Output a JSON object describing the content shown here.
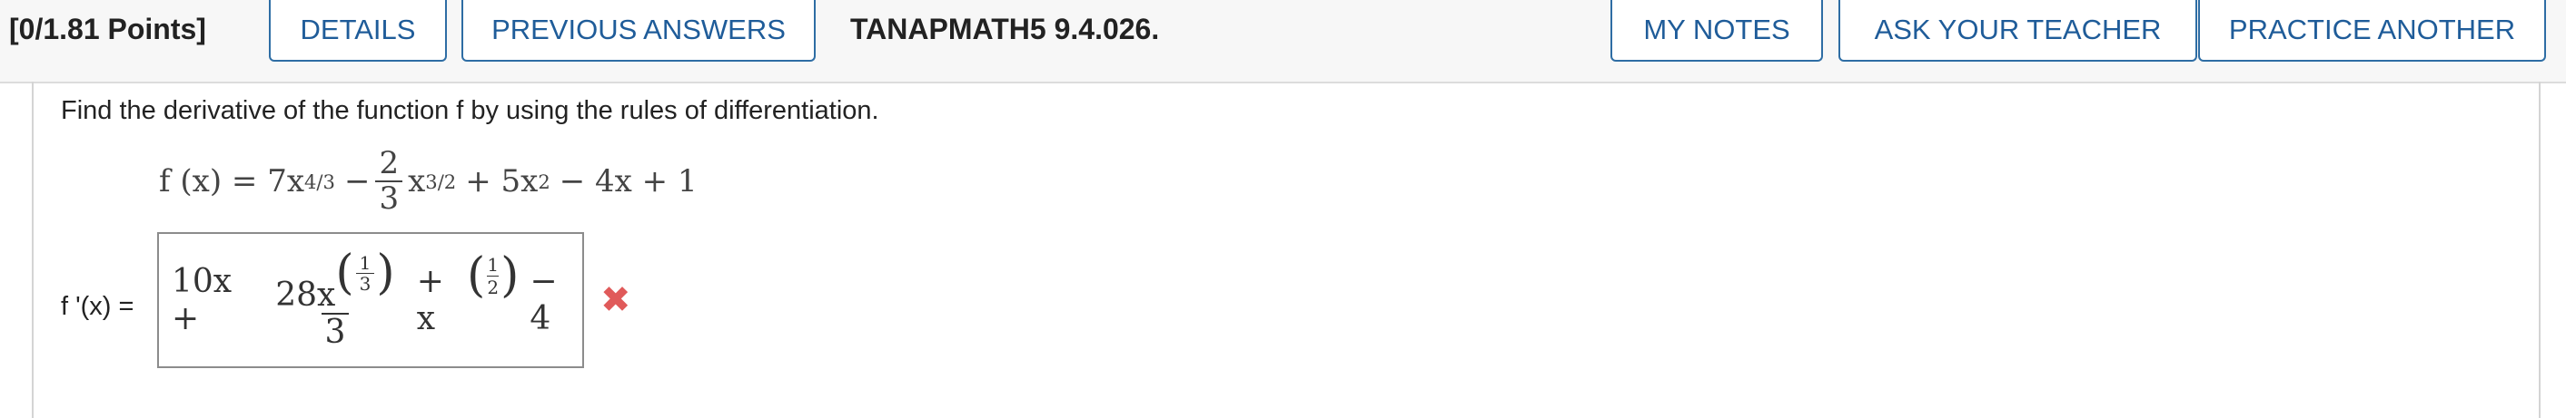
{
  "header": {
    "points": "[0/1.81 Points]",
    "details_label": "DETAILS",
    "previous_answers_label": "PREVIOUS ANSWERS",
    "question_id": "TANAPMATH5 9.4.026.",
    "my_notes_label": "MY NOTES",
    "ask_teacher_label": "ASK YOUR TEACHER",
    "practice_another_label": "PRACTICE ANOTHER"
  },
  "question": {
    "prompt": "Find the derivative of the function f by using the rules of differentiation.",
    "function_lhs": "f (x) = 7x",
    "function_exp1": "4/3",
    "function_minus": "−",
    "function_frac_num": "2",
    "function_frac_den": "3",
    "function_x": "x",
    "function_exp2": "3/2",
    "function_rest": "+ 5x",
    "function_exp3": "2",
    "function_tail": "− 4x + 1"
  },
  "answer": {
    "label": "f '(x) =",
    "term1": "10x +",
    "frac_num": "28x",
    "exp1_num": "1",
    "exp1_den": "3",
    "frac_den": "3",
    "plus_x": "+ x",
    "exp2_num": "1",
    "exp2_den": "2",
    "tail": "− 4",
    "status_icon": "cross-icon",
    "status_color": "#e05a5a"
  },
  "colors": {
    "accent": "#1f5c99",
    "border": "#2e6da4"
  }
}
